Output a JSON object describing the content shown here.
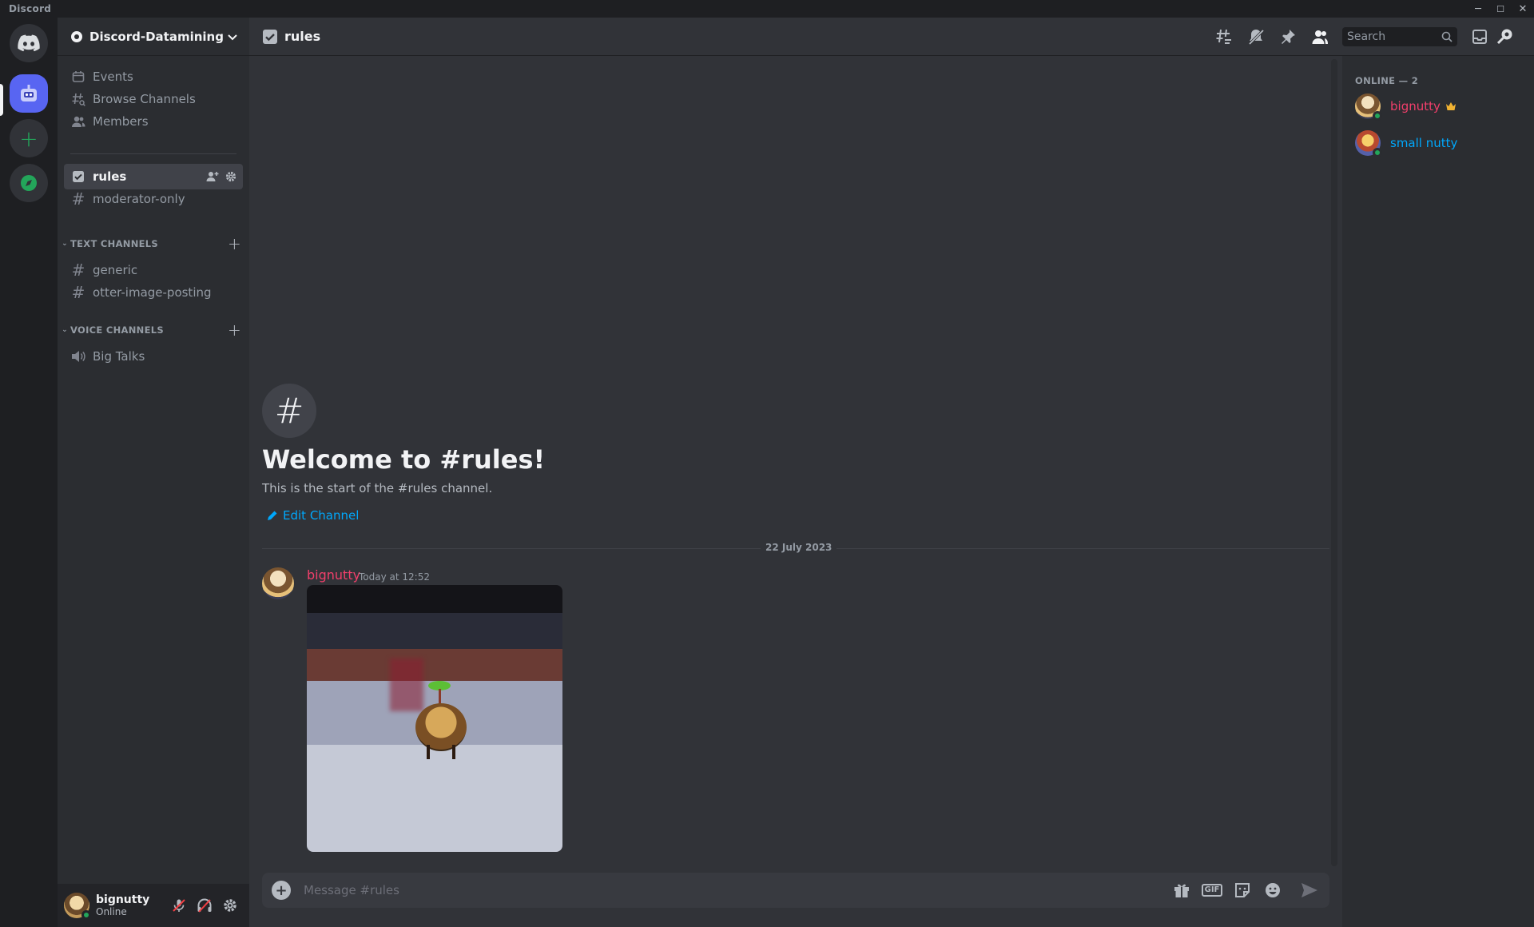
{
  "window": {
    "title": "Discord",
    "controls": [
      "─",
      "☐",
      "✕"
    ]
  },
  "guild": {
    "name": "Discord-Datamining"
  },
  "sidebar": {
    "top_items": [
      {
        "label": "Events",
        "icon": "calendar-icon"
      },
      {
        "label": "Browse Channels",
        "icon": "browse-channels-icon"
      },
      {
        "label": "Members",
        "icon": "members-icon"
      }
    ],
    "pinned_channels": [
      {
        "label": "rules",
        "icon": "rules-channel-icon",
        "active": true
      },
      {
        "label": "moderator-only",
        "icon": "hash-icon"
      }
    ],
    "categories": [
      {
        "label": "TEXT CHANNELS",
        "channels": [
          "generic",
          "otter-image-posting"
        ]
      },
      {
        "label": "VOICE CHANNELS",
        "channels": [
          "Big Talks"
        ]
      }
    ]
  },
  "user_panel": {
    "name": "bignutty",
    "status": "Online"
  },
  "header": {
    "channel": "rules",
    "search_placeholder": "Search"
  },
  "welcome": {
    "title": "Welcome to #rules!",
    "subtitle": "This is the start of the #rules channel.",
    "edit_label": "Edit Channel"
  },
  "messages": {
    "date_divider": "22 July 2023",
    "items": [
      {
        "author": "bignutty",
        "time": "Today at 12:52",
        "author_color": "#f23f6b"
      }
    ]
  },
  "composer": {
    "placeholder": "Message #rules",
    "gif_label": "GIF"
  },
  "members": {
    "heading": "ONLINE — 2",
    "list": [
      {
        "name": "bignutty",
        "color": "#f23f6b",
        "badge": "crown-icon"
      },
      {
        "name": "small nutty",
        "color": "#00a8fc"
      }
    ]
  },
  "colors": {
    "accent": "#5865f2",
    "online": "#23a55a",
    "link": "#00a8fc"
  }
}
